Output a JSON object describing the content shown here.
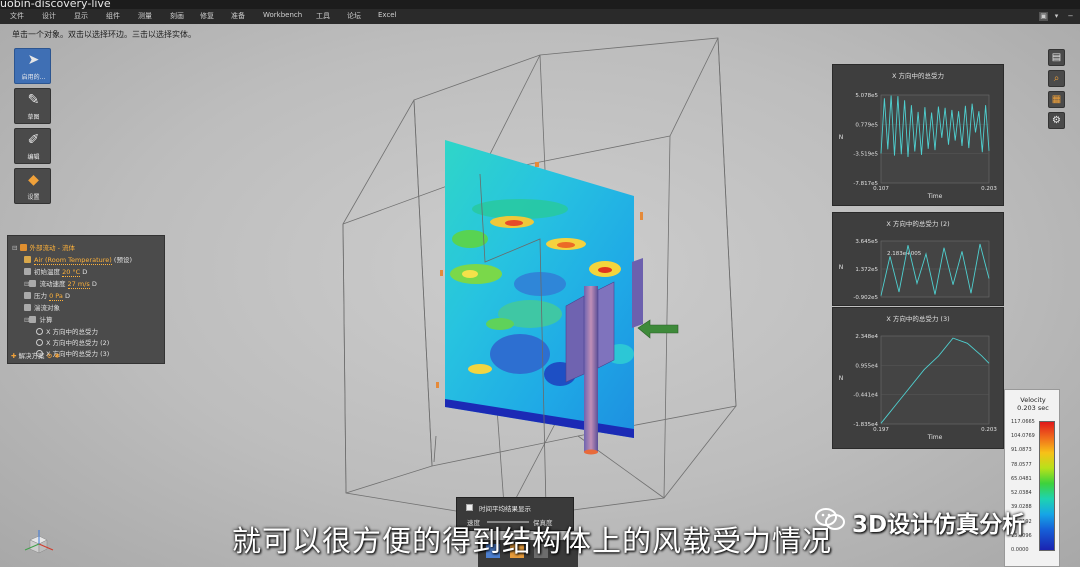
{
  "app": {
    "title": "uobin-discovery-live"
  },
  "menu": [
    "文件",
    "设计",
    "显示",
    "组件",
    "测量",
    "刻画",
    "修复",
    "准备",
    "Workbench",
    "工具",
    "论坛",
    "Excel"
  ],
  "status_hint": "单击一个对象。双击以选择环边。三击以选择实体。",
  "toolbar": [
    {
      "label": "启用的...",
      "icon": "cursor-icon",
      "active": true
    },
    {
      "label": "草图",
      "icon": "pencil-icon",
      "active": false
    },
    {
      "label": "编辑",
      "icon": "edit-brush-icon",
      "active": false
    },
    {
      "label": "设置",
      "icon": "setup-box-icon",
      "active": false
    }
  ],
  "tree": {
    "root": "外部流动 - 流体",
    "fluid_label": "Air (Room Temperature)",
    "fluid_suffix": "(预设)",
    "inlet_temp_label": "初始温度",
    "inlet_temp_value": "20 °C",
    "inlet_temp_code": "D",
    "flow_speed_label": "流动速度",
    "flow_speed_value": "27 m/s",
    "flow_speed_code": "D",
    "pressure_label": "压力",
    "pressure_value": "0 Pa",
    "pressure_code": "D",
    "turbulence_label": "湍流对象",
    "calc_label": "计算",
    "calc_items": [
      "X 方向中的总受力",
      "X 方向中的总受力 (2)",
      "X 方向中的总受力 (3)"
    ],
    "solution_label": "解决方案"
  },
  "charts": [
    {
      "title": "X 方向中的总受力",
      "ylabel": "N",
      "xlabel": "Time",
      "yticks": [
        "5.078e5",
        "0.779e5",
        "-3.519e5",
        "-7.817e5"
      ],
      "xticks": [
        "0.107",
        "0.203"
      ],
      "chart_data": {
        "type": "line",
        "x": [
          0.107,
          0.11,
          0.113,
          0.116,
          0.119,
          0.122,
          0.125,
          0.128,
          0.131,
          0.134,
          0.137,
          0.14,
          0.143,
          0.146,
          0.149,
          0.152,
          0.155,
          0.158,
          0.161,
          0.164,
          0.167,
          0.17,
          0.173,
          0.176,
          0.179,
          0.182,
          0.185,
          0.188,
          0.191,
          0.194,
          0.197,
          0.2,
          0.203
        ],
        "y": [
          -350000.0,
          460000.0,
          -290000.0,
          500000.0,
          -380000.0,
          490000.0,
          -360000.0,
          430000.0,
          -400000.0,
          360000.0,
          -320000.0,
          260000.0,
          -370000.0,
          330000.0,
          -280000.0,
          250000.0,
          -300000.0,
          340000.0,
          -120000.0,
          320000.0,
          -220000.0,
          290000.0,
          -160000.0,
          270000.0,
          -240000.0,
          350000.0,
          -270000.0,
          380000.0,
          -40000.0,
          270000.0,
          -330000.0,
          360000.0,
          -310000.0
        ],
        "ylim": [
          -781700.0,
          507800.0
        ],
        "xlim": [
          0.107,
          0.203
        ]
      }
    },
    {
      "title": "X 方向中的总受力 (2)",
      "ylabel": "N",
      "xlabel": "",
      "annotation": "2.183e+005",
      "yticks": [
        "3.645e5",
        "1.372e5",
        "-0.902e5"
      ],
      "xticks": [],
      "chart_data": {
        "type": "line",
        "x": [
          0.107,
          0.115,
          0.123,
          0.131,
          0.139,
          0.147,
          0.155,
          0.163,
          0.171,
          0.179,
          0.187,
          0.195,
          0.203
        ],
        "y": [
          -80000.0,
          240000.0,
          -50000.0,
          330000.0,
          20000.0,
          260000.0,
          -70000.0,
          310000.0,
          10000.0,
          280000.0,
          -60000.0,
          340000.0,
          60000.0
        ],
        "ylim": [
          -90200.0,
          364500.0
        ]
      }
    },
    {
      "title": "X 方向中的总受力 (3)",
      "ylabel": "N",
      "xlabel": "Time",
      "yticks": [
        "2.348e4",
        "0.955e4",
        "-0.441e4",
        "-1.835e4"
      ],
      "xticks": [
        "0.197",
        "0.203"
      ],
      "chart_data": {
        "type": "line",
        "x": [
          0.197,
          0.1978,
          0.1986,
          0.1994,
          0.2002,
          0.201,
          0.2018,
          0.2026,
          0.203
        ],
        "y": [
          -18000.0,
          -9500.0,
          -1000.0,
          7500.0,
          14000.0,
          22500.0,
          20000.0,
          14000.0,
          10500.0
        ],
        "ylim": [
          -18350.0,
          23480.0
        ],
        "xlim": [
          0.197,
          0.203
        ]
      }
    }
  ],
  "legend": {
    "title": "Velocity",
    "time": "0.203 sec",
    "ticks": [
      "117.0665",
      "104.0769",
      "91.0873",
      "78.0577",
      "65.0481",
      "52.0384",
      "39.0288",
      "26.0192",
      "13.0096",
      "0.0000"
    ]
  },
  "time_panel": {
    "option": "时间平均结果显示",
    "speed": "速度",
    "quality": "保真度"
  },
  "subtitle": "就可以很方便的得到结构体上的风载受力情况",
  "watermark": "3D设计仿真分析",
  "colors": {
    "accent": "#3f6fb4",
    "panel": "#3e3e3e",
    "chart_line": "#4fd0d0",
    "arrow": "#3e8a3a"
  }
}
